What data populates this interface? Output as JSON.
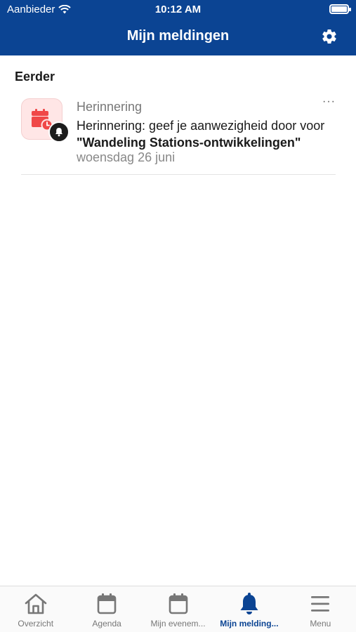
{
  "status_bar": {
    "carrier": "Aanbieder",
    "time": "10:12 AM"
  },
  "header": {
    "title": "Mijn meldingen",
    "settings_icon": "gear-icon"
  },
  "section": {
    "title": "Eerder"
  },
  "notifications": [
    {
      "category": "Herinnering",
      "text_prefix": "Herinnering: geef je aanwezigheid door voor",
      "event_title": "\"Wandeling Stations-ontwikkelingen\"",
      "date": "woensdag 26 juni",
      "icon": "calendar-clock-icon",
      "badge_icon": "bell-icon",
      "more_label": "···"
    }
  ],
  "tabbar": {
    "items": [
      {
        "label": "Overzicht",
        "icon": "home-icon",
        "active": false
      },
      {
        "label": "Agenda",
        "icon": "calendar-icon",
        "active": false
      },
      {
        "label": "Mijn evenem...",
        "icon": "calendar-icon",
        "active": false
      },
      {
        "label": "Mijn melding...",
        "icon": "bell-icon",
        "active": true
      },
      {
        "label": "Menu",
        "icon": "hamburger-icon",
        "active": false
      }
    ]
  },
  "colors": {
    "brand": "#0b4493",
    "accent_red": "#f04848",
    "icon_bg": "#ffe6e6"
  }
}
